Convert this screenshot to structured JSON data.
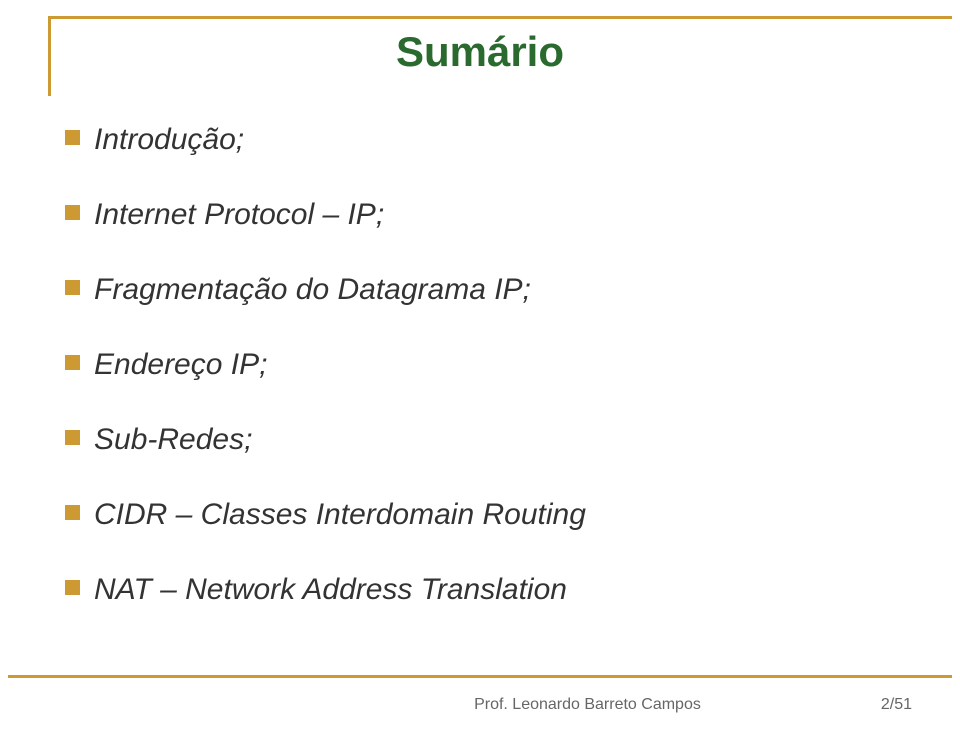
{
  "title": "Sumário",
  "bullets": [
    "Introdução;",
    "Internet Protocol – IP;",
    "Fragmentação do Datagrama IP;",
    "Endereço IP;",
    "Sub-Redes;",
    "CIDR – Classes Interdomain Routing",
    "NAT – Network Address Translation"
  ],
  "footer": {
    "author": "Prof. Leonardo Barreto Campos",
    "page": "2/51"
  }
}
